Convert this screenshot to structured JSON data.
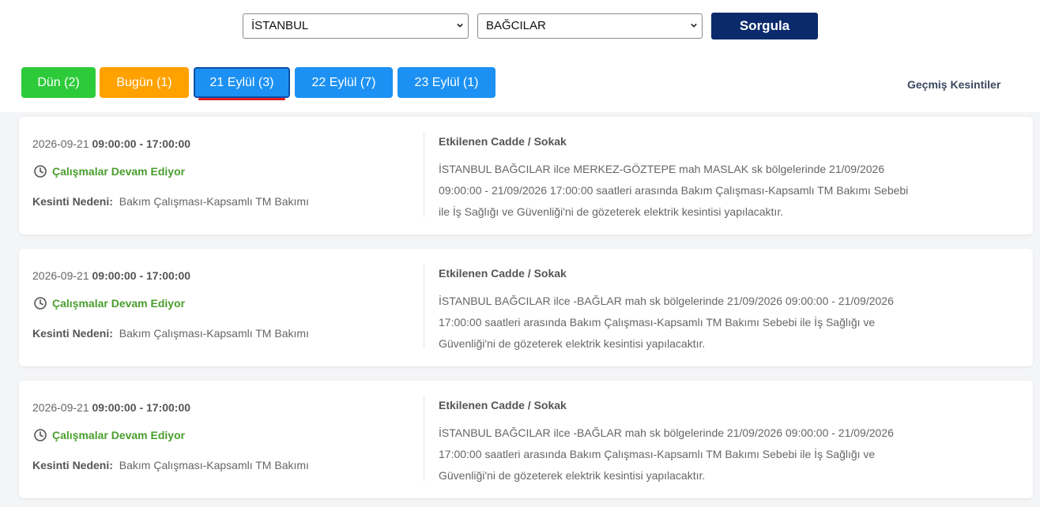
{
  "query": {
    "il_value": "İSTANBUL",
    "ilce_value": "BAĞCILAR",
    "submit_label": "Sorgula"
  },
  "tabs": [
    {
      "label": "Dün (2)"
    },
    {
      "label": "Bugün (1)"
    },
    {
      "label": "21 Eylül (3)"
    },
    {
      "label": "22 Eylül (7)"
    },
    {
      "label": "23 Eylül (1)"
    }
  ],
  "history_link": "Geçmiş Kesintiler",
  "colors": {
    "submit": "#0b2a6b",
    "tab_yesterday": "#2dcb3a",
    "tab_today": "#ffa200",
    "tab_date": "#1c91f3",
    "active_underline": "#e02020",
    "status_green": "#4a9e2e"
  },
  "cards": [
    {
      "date": "2026-09-21",
      "time": "09:00:00 - 17:00:00",
      "status": "Çalışmalar Devam Ediyor",
      "reason_label": "Kesinti Nedeni:",
      "reason": "Bakım Çalışması-Kapsamlı TM Bakımı",
      "street_title": "Etkilenen Cadde / Sokak",
      "street_lines": [
        "İSTANBUL BAĞCILAR ilce MERKEZ-GÖZTEPE mah MASLAK sk bölgelerinde 21/09/2026",
        "09:00:00 - 21/09/2026 17:00:00 saatleri arasında Bakım Çalışması-Kapsamlı TM Bakımı Sebebi",
        "ile İş Sağlığı ve Güvenliği'ni de gözeterek elektrik kesintisi yapılacaktır."
      ]
    },
    {
      "date": "2026-09-21",
      "time": "09:00:00 - 17:00:00",
      "status": "Çalışmalar Devam Ediyor",
      "reason_label": "Kesinti Nedeni:",
      "reason": "Bakım Çalışması-Kapsamlı TM Bakımı",
      "street_title": "Etkilenen Cadde / Sokak",
      "street_lines": [
        "İSTANBUL BAĞCILAR ilce -BAĞLAR mah sk bölgelerinde 21/09/2026 09:00:00 - 21/09/2026",
        "17:00:00 saatleri arasında Bakım Çalışması-Kapsamlı TM Bakımı Sebebi ile İş Sağlığı ve",
        "Güvenliği'ni de gözeterek elektrik kesintisi yapılacaktır."
      ]
    },
    {
      "date": "2026-09-21",
      "time": "09:00:00 - 17:00:00",
      "status": "Çalışmalar Devam Ediyor",
      "reason_label": "Kesinti Nedeni:",
      "reason": "Bakım Çalışması-Kapsamlı TM Bakımı",
      "street_title": "Etkilenen Cadde / Sokak",
      "street_lines": [
        "İSTANBUL BAĞCILAR ilce -BAĞLAR mah sk bölgelerinde 21/09/2026 09:00:00 - 21/09/2026",
        "17:00:00 saatleri arasında Bakım Çalışması-Kapsamlı TM Bakımı Sebebi ile İş Sağlığı ve",
        "Güvenliği'ni de gözeterek elektrik kesintisi yapılacaktır."
      ]
    }
  ]
}
